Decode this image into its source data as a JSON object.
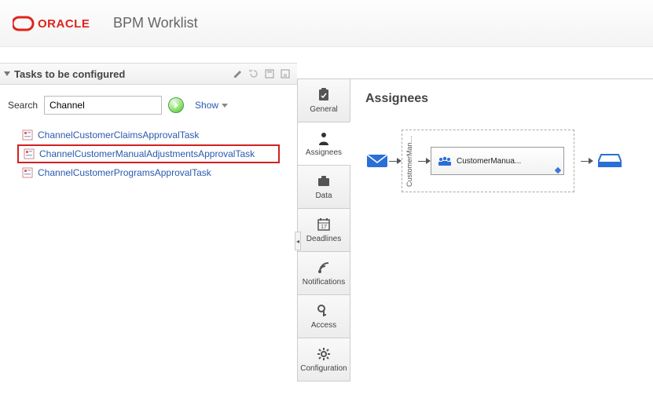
{
  "header": {
    "logo_text": "ORACLE",
    "app_title": "BPM Worklist"
  },
  "left": {
    "panel_title": "Tasks to be configured",
    "search_label": "Search",
    "search_value": "Channel",
    "show_label": "Show",
    "tasks": [
      {
        "label": "ChannelCustomerClaimsApprovalTask",
        "selected": false
      },
      {
        "label": "ChannelCustomerManualAdjustmentsApprovalTask",
        "selected": true
      },
      {
        "label": "ChannelCustomerProgramsApprovalTask",
        "selected": false
      }
    ]
  },
  "tabs": [
    {
      "key": "general",
      "label": "General"
    },
    {
      "key": "assignees",
      "label": "Assignees"
    },
    {
      "key": "data",
      "label": "Data"
    },
    {
      "key": "deadlines",
      "label": "Deadlines"
    },
    {
      "key": "notifications",
      "label": "Notifications"
    },
    {
      "key": "access",
      "label": "Access"
    },
    {
      "key": "configuration",
      "label": "Configuration"
    }
  ],
  "active_tab": "assignees",
  "main": {
    "title": "Assignees",
    "stage_label": "CustomerManua..",
    "node_label": "CustomerManua..."
  }
}
